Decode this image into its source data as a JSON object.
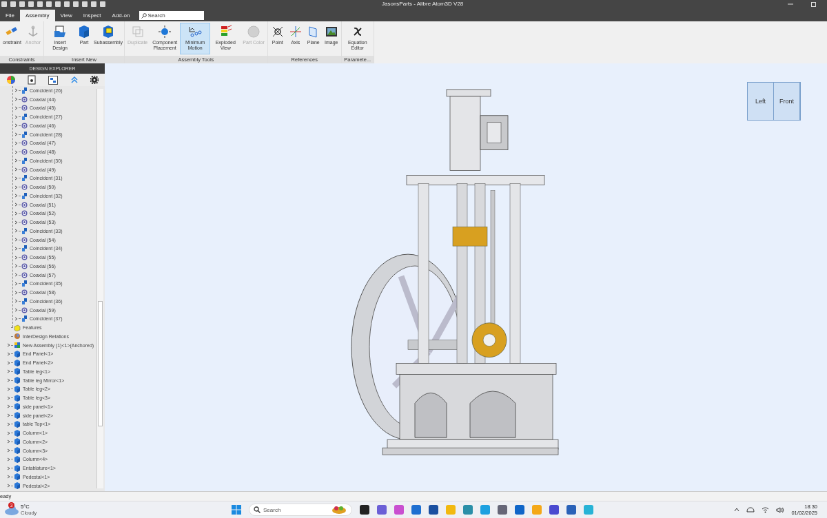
{
  "window": {
    "title": "JasonsParts - Alibre Atom3D V28"
  },
  "tabs": [
    {
      "label": "File",
      "selected": false
    },
    {
      "label": "Assembly",
      "selected": true
    },
    {
      "label": "View",
      "selected": false
    },
    {
      "label": "Inspect",
      "selected": false
    },
    {
      "label": "Add-on",
      "selected": false
    }
  ],
  "search": {
    "placeholder": "Search"
  },
  "ribbon": [
    {
      "label": "Constraints",
      "buttons": [
        {
          "kind": "constraint",
          "label": "onstraint",
          "disabled": false,
          "selected": false
        },
        {
          "kind": "anchor",
          "label": "Anchor",
          "disabled": true,
          "selected": false
        }
      ]
    },
    {
      "label": "Insert New",
      "buttons": [
        {
          "kind": "insert",
          "label": "Insert Design",
          "disabled": false,
          "selected": false
        },
        {
          "kind": "part",
          "label": "Part",
          "disabled": false,
          "selected": false
        },
        {
          "kind": "subassembly",
          "label": "Subassembly",
          "disabled": false,
          "selected": false
        }
      ]
    },
    {
      "label": "Assembly Tools",
      "buttons": [
        {
          "kind": "duplicate",
          "label": "Duplicate",
          "disabled": true,
          "selected": false
        },
        {
          "kind": "placement",
          "label": "Component Placement",
          "disabled": false,
          "selected": false
        },
        {
          "kind": "motion",
          "label": "Minimum Motion",
          "disabled": false,
          "selected": true
        },
        {
          "kind": "exploded",
          "label": "Exploded View",
          "disabled": false,
          "selected": false
        },
        {
          "kind": "color",
          "label": "Part Color",
          "disabled": true,
          "selected": false
        }
      ]
    },
    {
      "label": "References",
      "buttons": [
        {
          "kind": "point",
          "label": "Point",
          "disabled": false,
          "selected": false
        },
        {
          "kind": "axis",
          "label": "Axis",
          "disabled": false,
          "selected": false
        },
        {
          "kind": "plane",
          "label": "Plane",
          "disabled": false,
          "selected": false
        },
        {
          "kind": "image",
          "label": "Image",
          "disabled": false,
          "selected": false
        }
      ]
    },
    {
      "label": "Paramete...",
      "buttons": [
        {
          "kind": "equation",
          "label": "Equation Editor",
          "disabled": false,
          "selected": false
        }
      ]
    }
  ],
  "explorer": {
    "title": "DESIGN EXPLORER",
    "constraints": [
      {
        "kind": "coincident",
        "label": "Coincident (26)"
      },
      {
        "kind": "coaxial",
        "label": "Coaxial (44)"
      },
      {
        "kind": "coaxial",
        "label": "Coaxial (45)"
      },
      {
        "kind": "coincident",
        "label": "Coincident (27)"
      },
      {
        "kind": "coaxial",
        "label": "Coaxial (46)"
      },
      {
        "kind": "coincident",
        "label": "Coincident (28)"
      },
      {
        "kind": "coaxial",
        "label": "Coaxial (47)"
      },
      {
        "kind": "coaxial",
        "label": "Coaxial (48)"
      },
      {
        "kind": "coincident",
        "label": "Coincident (30)"
      },
      {
        "kind": "coaxial",
        "label": "Coaxial (49)"
      },
      {
        "kind": "coincident",
        "label": "Coincident (31)"
      },
      {
        "kind": "coaxial",
        "label": "Coaxial (50)"
      },
      {
        "kind": "coincident",
        "label": "Coincident (32)"
      },
      {
        "kind": "coaxial",
        "label": "Coaxial (51)"
      },
      {
        "kind": "coaxial",
        "label": "Coaxial (52)"
      },
      {
        "kind": "coaxial",
        "label": "Coaxial (53)"
      },
      {
        "kind": "coincident",
        "label": "Coincident (33)"
      },
      {
        "kind": "coaxial",
        "label": "Coaxial (54)"
      },
      {
        "kind": "coincident",
        "label": "Coincident (34)"
      },
      {
        "kind": "coaxial",
        "label": "Coaxial (55)"
      },
      {
        "kind": "coaxial",
        "label": "Coaxial (56)"
      },
      {
        "kind": "coaxial",
        "label": "Coaxial (57)"
      },
      {
        "kind": "coincident",
        "label": "Coincident (35)"
      },
      {
        "kind": "coaxial",
        "label": "Coaxial (58)"
      },
      {
        "kind": "coincident",
        "label": "Coincident (36)"
      },
      {
        "kind": "coaxial",
        "label": "Coaxial (59)"
      },
      {
        "kind": "coincident",
        "label": "Coincident (37)"
      }
    ],
    "items": [
      {
        "kind": "features",
        "label": "Features",
        "expandable": false
      },
      {
        "kind": "interdesign",
        "label": "InterDesign Relations",
        "expandable": false
      },
      {
        "kind": "assembly",
        "label": "New Assembly (1)<1>(Anchored)",
        "expandable": true
      },
      {
        "kind": "part",
        "label": "End Panel<1>",
        "expandable": true
      },
      {
        "kind": "part",
        "label": "End Panel<2>",
        "expandable": true
      },
      {
        "kind": "part",
        "label": "Table leg<1>",
        "expandable": true
      },
      {
        "kind": "part",
        "label": "Table leg Mirror<1>",
        "expandable": true
      },
      {
        "kind": "part",
        "label": "Table leg<2>",
        "expandable": true
      },
      {
        "kind": "part",
        "label": "Table leg<3>",
        "expandable": true
      },
      {
        "kind": "part",
        "label": "side panel<1>",
        "expandable": true
      },
      {
        "kind": "part",
        "label": "side panel<2>",
        "expandable": true
      },
      {
        "kind": "part",
        "label": "table Top<1>",
        "expandable": true
      },
      {
        "kind": "part",
        "label": "Column<1>",
        "expandable": true
      },
      {
        "kind": "part",
        "label": "Column<2>",
        "expandable": true
      },
      {
        "kind": "part",
        "label": "Column<3>",
        "expandable": true
      },
      {
        "kind": "part",
        "label": "Column<4>",
        "expandable": true
      },
      {
        "kind": "part",
        "label": "Entablature<1>",
        "expandable": true
      },
      {
        "kind": "part",
        "label": "Pedestal<1>",
        "expandable": true
      },
      {
        "kind": "part",
        "label": "Pedestal<2>",
        "expandable": true
      }
    ]
  },
  "view_cube": {
    "left": "Left",
    "front": "Front"
  },
  "status_bar": {
    "text": "eady"
  },
  "taskbar": {
    "weather": {
      "badge": "3",
      "temperature": "5°C",
      "condition": "Cloudy"
    },
    "search": {
      "placeholder": "Search"
    },
    "time": "18:30",
    "date": "01/02/2025"
  }
}
